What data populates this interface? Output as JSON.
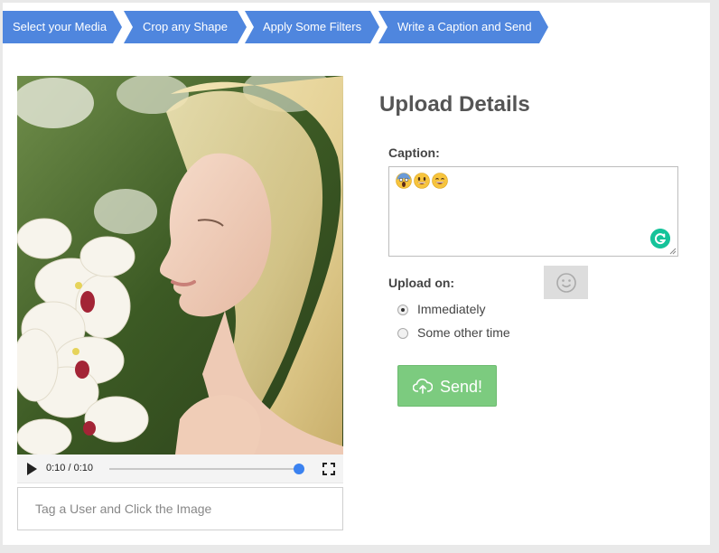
{
  "wizard": {
    "steps": [
      {
        "label": "Select your Media"
      },
      {
        "label": "Crop any Shape"
      },
      {
        "label": "Apply Some Filters"
      },
      {
        "label": "Write a Caption and Send"
      }
    ],
    "color": "#4f86de"
  },
  "media": {
    "image": "woman-smelling-orchids-photo",
    "player": {
      "time": "0:10 / 0:10",
      "progress": 1.0,
      "play_icon": "play-icon",
      "fullscreen_icon": "fullscreen-icon"
    },
    "tag_placeholder": "Tag a User and Click the Image"
  },
  "details": {
    "title": "Upload Details",
    "caption_label": "Caption:",
    "caption_emojis": [
      "screaming-face-emoji",
      "grinning-face-emoji",
      "smiling-face-emoji"
    ],
    "grammarly_icon": "grammarly-icon",
    "upload_label": "Upload on:",
    "emoji_picker_icon": "smiley-icon",
    "options": [
      {
        "label": "Immediately",
        "checked": true
      },
      {
        "label": "Some other time",
        "checked": false
      }
    ],
    "send_label": "Send!",
    "send_icon": "cloud-upload-icon",
    "send_color": "#7ccb7f"
  }
}
